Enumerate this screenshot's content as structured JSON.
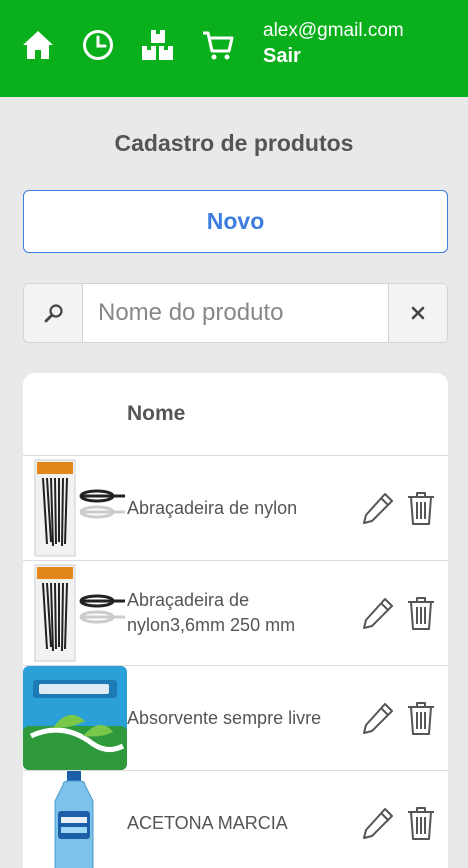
{
  "header": {
    "nav": [
      {
        "name": "home-icon"
      },
      {
        "name": "history-icon"
      },
      {
        "name": "boxes-icon"
      },
      {
        "name": "cart-icon"
      }
    ],
    "user_email": "alex@gmail.com",
    "logout_label": "Sair",
    "background_color": "#0aaf1c"
  },
  "main": {
    "title": "Cadastro de produtos",
    "new_button_label": "Novo",
    "search": {
      "placeholder": "Nome do produto",
      "value": ""
    },
    "table": {
      "header_name": "Nome",
      "rows": [
        {
          "name": "Abraçadeira de nylon",
          "image": "cable-ties-image"
        },
        {
          "name": "Abraçadeira de nylon3,6mm 250 mm",
          "image": "cable-ties-image"
        },
        {
          "name": "Absorvente sempre livre",
          "image": "sanitary-pad-package-image"
        },
        {
          "name": "ACETONA MARCIA",
          "image": "acetone-bottle-image"
        }
      ]
    }
  },
  "colors": {
    "accent": "#3b7de0",
    "header_green": "#0aaf1c",
    "background": "#e9e9e9"
  }
}
